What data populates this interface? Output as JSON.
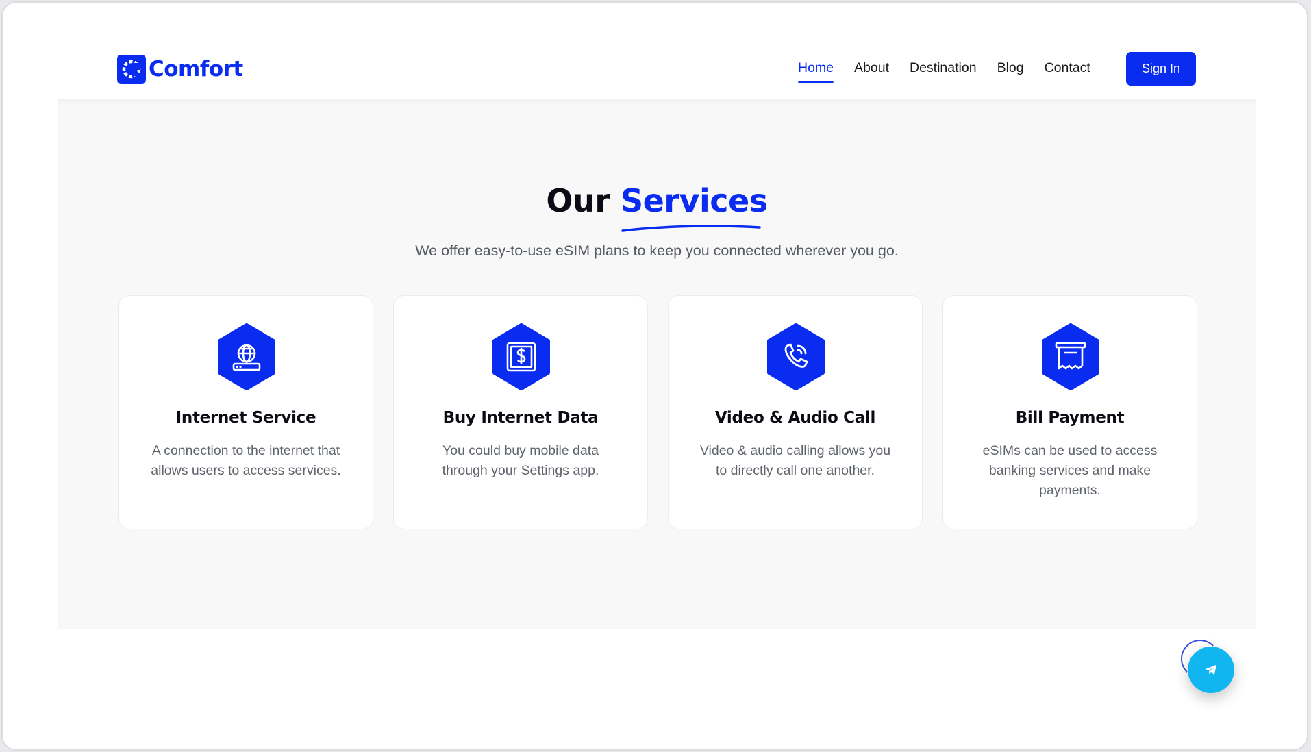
{
  "header": {
    "logo_text": "Comfort",
    "nav": [
      "Home",
      "About",
      "Destination",
      "Blog",
      "Contact"
    ],
    "active_nav": "Home",
    "signin_label": "Sign In"
  },
  "services": {
    "title_plain": "Our",
    "title_accent": "Services",
    "subtitle": "We offer easy-to-use eSIM plans to keep you connected wherever you go.",
    "cards": [
      {
        "icon": "globe-router-icon",
        "title": "Internet Service",
        "description": "A connection to the internet that allows users to access services."
      },
      {
        "icon": "dollar-tablet-icon",
        "title": "Buy Internet Data",
        "description": "You could buy mobile data through your Settings app."
      },
      {
        "icon": "phone-call-icon",
        "title": "Video & Audio Call",
        "description": "Video & audio calling allows you to directly call one another."
      },
      {
        "icon": "receipt-icon",
        "title": "Bill Payment",
        "description": "eSIMs can be used to access banking services and make payments."
      }
    ]
  },
  "fab": {
    "icon": "send-plane-icon"
  },
  "colors": {
    "brand": "#0a2cf0",
    "fab": "#11b5f0",
    "section_bg": "#f8f8f9"
  }
}
